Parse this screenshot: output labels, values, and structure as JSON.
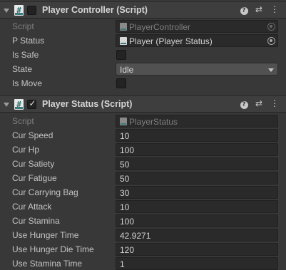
{
  "player_controller": {
    "title": "Player Controller (Script)",
    "enabled": false,
    "icon_glyph": "#",
    "fields": {
      "script_label": "Script",
      "script_value": "PlayerController",
      "p_status_label": "P Status",
      "p_status_value": "Player (Player Status)",
      "is_safe_label": "Is Safe",
      "is_safe_checked": false,
      "state_label": "State",
      "state_value": "Idle",
      "is_move_label": "Is Move",
      "is_move_checked": false
    }
  },
  "player_status": {
    "title": "Player Status (Script)",
    "enabled": true,
    "icon_glyph": "#",
    "enable_glyph": "✓",
    "fields": [
      {
        "label": "Script",
        "value": "PlayerStatus"
      },
      {
        "label": "Cur Speed",
        "value": "10"
      },
      {
        "label": "Cur Hp",
        "value": "100"
      },
      {
        "label": "Cur Satiety",
        "value": "50"
      },
      {
        "label": "Cur Fatigue",
        "value": "50"
      },
      {
        "label": "Cur Carrying Bag",
        "value": "30"
      },
      {
        "label": "Cur Attack",
        "value": "10"
      },
      {
        "label": "Cur Stamina",
        "value": "100"
      },
      {
        "label": "Use Hunger Time",
        "value": "42.9271"
      },
      {
        "label": "Use Hunger Die Time",
        "value": "120"
      },
      {
        "label": "Use Stamina Time",
        "value": "1"
      }
    ]
  },
  "header_icons": {
    "help_glyph": "?",
    "preset_glyph": "⇄",
    "menu_glyph": "⋮"
  },
  "colors": {
    "background": "#383838",
    "header": "#3e3e3e",
    "field": "#2a2a2a",
    "dropdown": "#515151"
  }
}
